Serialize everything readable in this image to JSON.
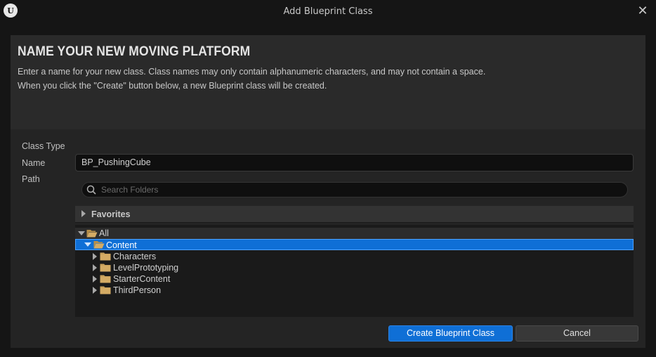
{
  "window": {
    "title": "Add Blueprint Class",
    "logo_text": "U"
  },
  "header": {
    "heading": "NAME YOUR NEW MOVING PLATFORM",
    "description_line1": "Enter a name for your new class. Class names may only contain alphanumeric characters, and may not contain a space.",
    "description_line2": "When you click the \"Create\" button below, a new Blueprint class will be created."
  },
  "form": {
    "class_type_label": "Class Type",
    "name_label": "Name",
    "path_label": "Path",
    "name_value": "BP_PushingCube",
    "search_placeholder": "Search Folders"
  },
  "tree": {
    "favorites_label": "Favorites",
    "all_label": "All",
    "content_label": "Content",
    "children": [
      "Characters",
      "LevelPrototyping",
      "StarterContent",
      "ThirdPerson"
    ]
  },
  "buttons": {
    "create_label": "Create Blueprint Class",
    "cancel_label": "Cancel"
  },
  "colors": {
    "accent": "#0f6fd6",
    "folder": "#c8a05a",
    "background": "#151515"
  },
  "icons": {
    "close": "close-icon",
    "search": "search-icon",
    "folder": "folder-icon",
    "folder_open": "folder-open-icon"
  }
}
